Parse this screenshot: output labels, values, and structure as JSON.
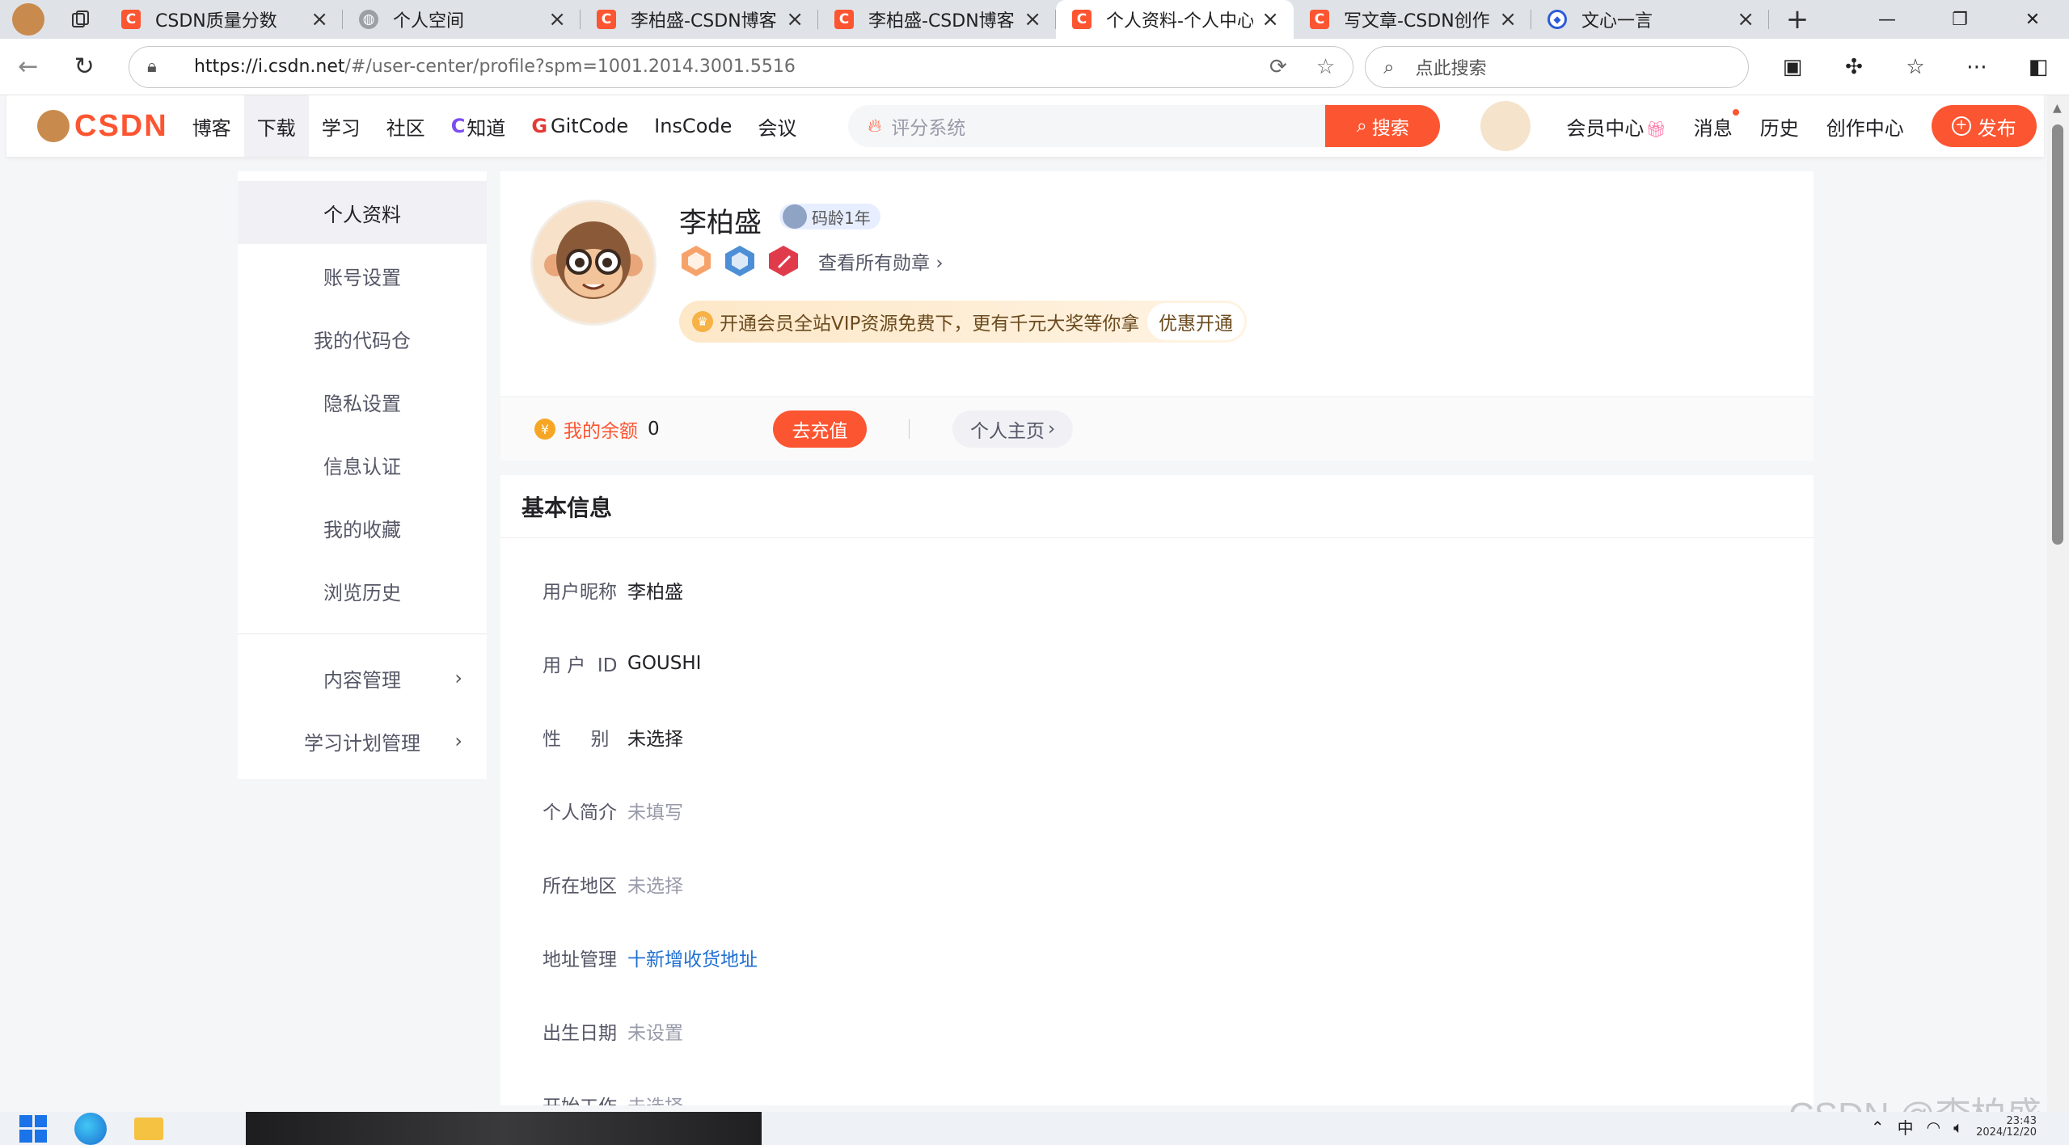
{
  "browser": {
    "tabs": [
      {
        "title": "CSDN质量分数",
        "icon": "csdn-icon",
        "active": false
      },
      {
        "title": "个人空间",
        "icon": "globe-icon",
        "active": false
      },
      {
        "title": "李柏盛-CSDN博客",
        "icon": "csdn-icon",
        "active": false
      },
      {
        "title": "李柏盛-CSDN博客",
        "icon": "csdn-icon",
        "active": false
      },
      {
        "title": "个人资料-个人中心-CS",
        "icon": "csdn-icon",
        "active": true
      },
      {
        "title": "写文章-CSDN创作中心",
        "icon": "csdn-icon",
        "active": false
      },
      {
        "title": "文心一言",
        "icon": "wenxin-icon",
        "active": false
      }
    ],
    "url_host": "https://i.csdn.net",
    "url_path": "/#/user-center/profile?spm=1001.2014.3001.5516",
    "search_placeholder": "点此搜索"
  },
  "header": {
    "logo_text": "CSDN",
    "nav": [
      {
        "label": "博客",
        "active": false
      },
      {
        "label": "下载",
        "active": true
      },
      {
        "label": "学习",
        "active": false
      },
      {
        "label": "社区",
        "active": false
      },
      {
        "label": "知道",
        "prefix": "C",
        "active": false
      },
      {
        "label": "GitCode",
        "prefix": "G",
        "active": false
      },
      {
        "label": "InsCode",
        "active": false
      },
      {
        "label": "会议",
        "active": false
      }
    ],
    "search_placeholder": "评分系统",
    "search_button": "搜索",
    "right_links": [
      "会员中心",
      "消息",
      "历史",
      "创作中心"
    ],
    "publish_button": "发布",
    "accent_color": "#fc5531"
  },
  "sidebar": {
    "items": [
      {
        "label": "个人资料",
        "active": true
      },
      {
        "label": "账号设置",
        "active": false
      },
      {
        "label": "我的代码仓",
        "active": false
      },
      {
        "label": "隐私设置",
        "active": false
      },
      {
        "label": "信息认证",
        "active": false
      },
      {
        "label": "我的收藏",
        "active": false
      },
      {
        "label": "浏览历史",
        "active": false
      }
    ],
    "expandable": [
      {
        "label": "内容管理"
      },
      {
        "label": "学习计划管理"
      }
    ]
  },
  "profile": {
    "name": "李柏盛",
    "code_age": "码龄1年",
    "view_badges": "查看所有勋章",
    "vip_text": "开通会员全站VIP资源免费下，更有千元大奖等你拿",
    "vip_button": "优惠开通",
    "balance_label": "我的余额",
    "balance_value": "0",
    "recharge_button": "去充值",
    "homepage_button": "个人主页"
  },
  "basic_info": {
    "title": "基本信息",
    "rows": [
      {
        "key": "用户昵称",
        "value": "李柏盛",
        "style": "normal"
      },
      {
        "key": "用 户  ID",
        "value": "GOUSHI",
        "style": "normal"
      },
      {
        "key": "性     别",
        "value": "未选择",
        "style": "normal"
      },
      {
        "key": "个人简介",
        "value": "未填写",
        "style": "muted"
      },
      {
        "key": "所在地区",
        "value": "未选择",
        "style": "muted"
      },
      {
        "key": "地址管理",
        "value": "十新增收货地址",
        "style": "link"
      },
      {
        "key": "出生日期",
        "value": "未设置",
        "style": "muted"
      },
      {
        "key": "开始工作",
        "value": "未选择",
        "style": "muted"
      }
    ]
  },
  "watermark": "CSDN @李柏盛",
  "taskbar": {
    "ime": "中",
    "time": "23:43",
    "date": "2024/12/20"
  }
}
